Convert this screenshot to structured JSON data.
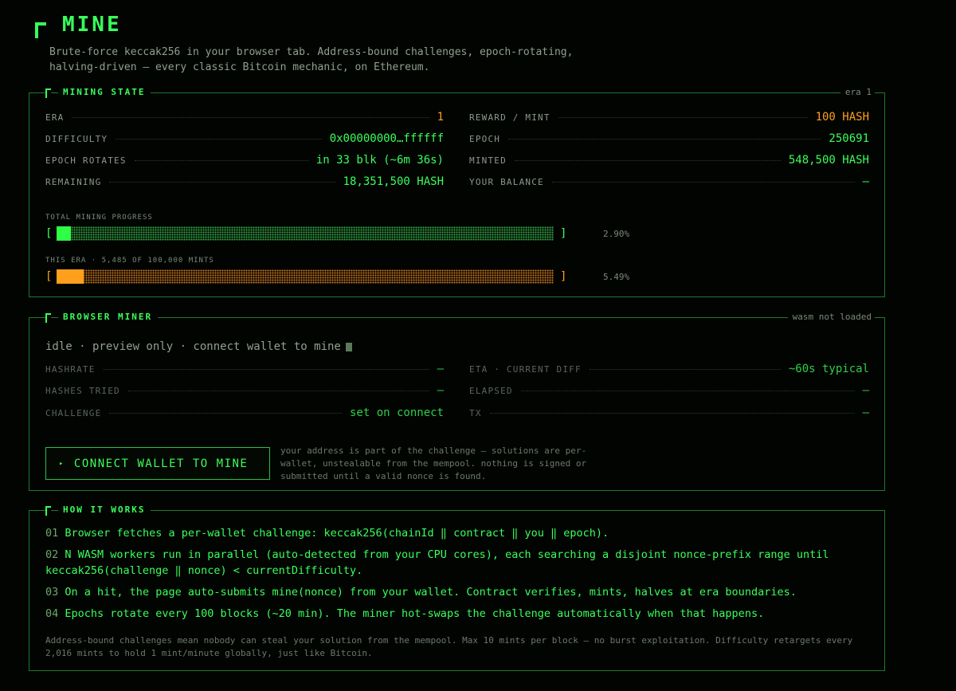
{
  "header": {
    "title": "MINE",
    "subtitle": "Brute-force keccak256 in your browser tab. Address-bound challenges, epoch-rotating,\nhalving-driven — every classic Bitcoin mechanic, on Ethereum."
  },
  "mining_state": {
    "title": "MINING STATE",
    "tag": "era 1",
    "left": [
      {
        "key": "ERA",
        "value": "1"
      },
      {
        "key": "DIFFICULTY",
        "value": "0x00000000…ffffff"
      },
      {
        "key": "EPOCH ROTATES",
        "value": "in 33 blk (~6m 36s)"
      },
      {
        "key": "REMAINING",
        "value": "18,351,500 HASH"
      }
    ],
    "right": [
      {
        "key": "REWARD / MINT",
        "value": "100 HASH"
      },
      {
        "key": "EPOCH",
        "value": "250691"
      },
      {
        "key": "MINTED",
        "value": "548,500 HASH"
      },
      {
        "key": "YOUR BALANCE",
        "value": "—"
      }
    ],
    "total_progress": {
      "label": "TOTAL MINING PROGRESS",
      "fraction": 0.029,
      "percent_text": "2.90%"
    },
    "era_progress": {
      "label": "THIS ERA · 5,485 OF 100,000 MINTS",
      "fraction": 0.0549,
      "percent_text": "5.49%"
    },
    "bracket_open": "[",
    "bracket_close": "]"
  },
  "browser_miner": {
    "title": "BROWSER MINER",
    "tag": "wasm not loaded",
    "status": "idle · preview only · connect wallet to mine",
    "left": [
      {
        "key": "HASHRATE",
        "value": "—"
      },
      {
        "key": "HASHES TRIED",
        "value": "—"
      },
      {
        "key": "CHALLENGE",
        "value": "set on connect"
      }
    ],
    "right": [
      {
        "key": "ETA · CURRENT DIFF",
        "value": "~60s typical"
      },
      {
        "key": "ELAPSED",
        "value": "—"
      },
      {
        "key": "TX",
        "value": "—"
      }
    ],
    "button_arrow": "▸",
    "button_label": "CONNECT WALLET TO MINE",
    "note": "your address is part of the challenge — solutions are per-wallet, unstealable from the mempool. nothing is signed or submitted until a valid nonce is found."
  },
  "how_it_works": {
    "title": "HOW IT WORKS",
    "steps": [
      {
        "num": "01",
        "text": "Browser fetches a per-wallet challenge: keccak256(chainId ‖ contract ‖ you ‖ epoch)."
      },
      {
        "num": "02",
        "text": "N WASM workers run in parallel (auto-detected from your CPU cores), each searching a disjoint nonce-prefix range until keccak256(challenge ‖ nonce) < currentDifficulty."
      },
      {
        "num": "03",
        "text": "On a hit, the page auto-submits mine(nonce) from your wallet. Contract verifies, mints, halves at era boundaries."
      },
      {
        "num": "04",
        "text": "Epochs rotate every 100 blocks (~20 min). The miner hot-swaps the challenge automatically when that happens."
      }
    ],
    "note": "Address-bound challenges mean nobody can steal your solution from the mempool. Max 10 mints per block — no burst exploitation. Difficulty retargets every 2,016 mints to hold 1 mint/minute globally, just like Bitcoin."
  },
  "colors": {
    "accent_green": "#39ff5a",
    "accent_orange": "#ff9f1c",
    "background": "#020402",
    "border": "#1f7a2c"
  }
}
